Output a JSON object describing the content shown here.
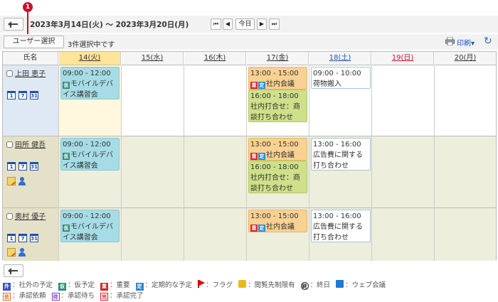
{
  "header": {
    "marker": "1",
    "date_range": "2023年3月14日(火) ～ 2023年3月20日(月)",
    "nav_first": "⏮",
    "nav_prev": "◀",
    "nav_today": "今日",
    "nav_next": "▶",
    "nav_last": "⏭"
  },
  "toolbar": {
    "user_select": "ユーザー選択",
    "selected_text": "3件選択中です",
    "print": "印刷▾",
    "refresh": "↻"
  },
  "columns": {
    "name": "氏名",
    "days": [
      "14(火)",
      "15(水)",
      "16(木)",
      "17(金)",
      "18(土)",
      "19(日)",
      "20(月)"
    ],
    "day_colors": [
      "#333333",
      "#333333",
      "#333333",
      "#333333",
      "#1a57b0",
      "#c8102e",
      "#333333"
    ]
  },
  "users": [
    {
      "name": "上田 恵子"
    },
    {
      "name": "田所 健吾"
    },
    {
      "name": "奥村 優子"
    }
  ],
  "cal_icons": [
    "1",
    "7",
    "31"
  ],
  "events": {
    "mobile_time": "09:00 - 12:00",
    "mobile_tag": "仮",
    "mobile_title": "モバイルデバイス講習会",
    "meeting_time": "13:00 - 15:00",
    "meeting_tag1": "重",
    "meeting_tag2": "定",
    "meeting_title": "社内会議",
    "uchiawase_time": "16:00 - 18:00",
    "uchiawase_title": "社内打合せ：商談打ち合わせ",
    "nimotsu_time": "09:00 - 10:00",
    "nimotsu_title": "荷物搬入",
    "koukoku_time": "13:00 - 16:00",
    "koukoku_title": "広告費に関する打ち合わせ"
  },
  "legend": {
    "row1": [
      {
        "icon": "外",
        "label": "：社外の予定"
      },
      {
        "icon": "仮",
        "label": "：仮予定"
      },
      {
        "icon": "重",
        "label": "：重要"
      },
      {
        "icon": "定",
        "label": "：定期的な予定"
      },
      {
        "icon": "flag-icon",
        "label": "：フラグ"
      },
      {
        "icon": "lock-icon",
        "label": "：閲覧先制限有"
      },
      {
        "icon": "終",
        "label": "：終日"
      },
      {
        "icon": "web-icon",
        "label": "：ウェブ会議"
      }
    ],
    "row2": [
      {
        "icon": "依",
        "label": "：承認依頼"
      },
      {
        "icon": "待",
        "label": "：承認待ち"
      },
      {
        "icon": "完",
        "label": "：承認完了"
      }
    ]
  }
}
